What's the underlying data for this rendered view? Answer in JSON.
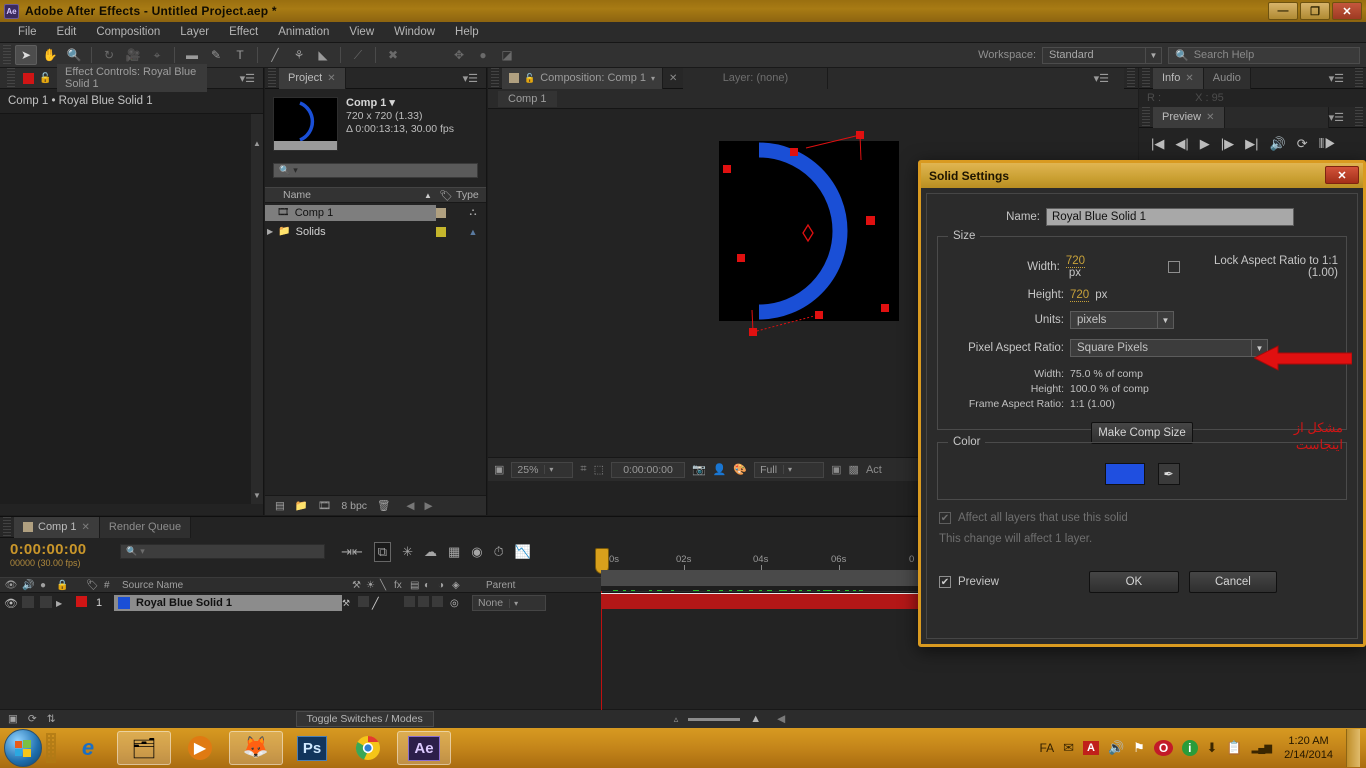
{
  "titlebar": {
    "app_icon": "ae-logo-icon",
    "title": "Adobe After Effects - Untitled Project.aep *",
    "minimize": "—",
    "restore": "❐",
    "close": "✕"
  },
  "menubar": {
    "items": [
      "File",
      "Edit",
      "Composition",
      "Layer",
      "Effect",
      "Animation",
      "View",
      "Window",
      "Help"
    ]
  },
  "toolbar": {
    "tools": [
      {
        "name": "selection-tool",
        "glyph": "➤",
        "active": true
      },
      {
        "name": "hand-tool",
        "glyph": "✋",
        "active": false
      },
      {
        "name": "zoom-tool",
        "glyph": "🔍",
        "active": false
      },
      {
        "name": "rotation-tool",
        "glyph": "↻",
        "active": false
      },
      {
        "name": "camera-tool",
        "glyph": "🎥",
        "active": false
      },
      {
        "name": "pan-behind-tool",
        "glyph": "⌖",
        "active": false
      },
      {
        "name": "shape-tool",
        "glyph": "▬",
        "active": false
      },
      {
        "name": "pen-tool",
        "glyph": "✎",
        "active": false
      },
      {
        "name": "type-tool",
        "glyph": "T",
        "active": false
      },
      {
        "name": "brush-tool",
        "glyph": "╱",
        "active": false
      },
      {
        "name": "clone-stamp-tool",
        "glyph": "⚘",
        "active": false
      },
      {
        "name": "eraser-tool",
        "glyph": "◣",
        "active": false
      },
      {
        "name": "roto-brush-tool",
        "glyph": "⟋",
        "active": false
      },
      {
        "name": "puppet-pin-tool",
        "glyph": "✖",
        "active": false
      }
    ],
    "right_tools": [
      {
        "name": "transform-icon",
        "glyph": "✥"
      },
      {
        "name": "dot-icon",
        "glyph": "●"
      },
      {
        "name": "mask-icon",
        "glyph": "◪"
      }
    ],
    "workspace_label": "Workspace:",
    "workspace_value": "Standard",
    "search_placeholder": "Search Help",
    "search_icon": "search-icon"
  },
  "effect_controls": {
    "tab_label": "Effect Controls: Royal Blue Solid 1",
    "swatch_icon": "red-square-icon",
    "lock_icon": "lock-icon",
    "menu_icon": "panel-menu-icon",
    "subtitle": "Comp 1 • Royal Blue Solid 1"
  },
  "project": {
    "tab_label": "Project",
    "tab_close": "✕",
    "menu_icon": "panel-menu-icon",
    "item_name": "Comp 1",
    "item_dropdown": "▾",
    "resolution": "720 x 720 (1.33)",
    "duration": "Δ 0:00:13:13, 30.00 fps",
    "search_icon": "search-icon",
    "search_dropdown": "▾",
    "columns": {
      "name": "Name",
      "sort": "▲",
      "tag": "tag-icon",
      "type": "Type"
    },
    "rows": [
      {
        "label": "Comp 1",
        "icon": "composition-icon",
        "color": "#b0a080",
        "selected": true
      },
      {
        "label": "Solids",
        "icon": "folder-icon",
        "color": "#c5b62c",
        "selected": false
      }
    ],
    "bottom": {
      "new_comp_icon": "new-composition-icon",
      "new_folder_icon": "new-folder-icon",
      "footage_icon": "footage-icon",
      "bit_depth": "8 bpc",
      "delete_icon": "trash-icon",
      "prev_icon": "◀",
      "next_icon": "▶"
    }
  },
  "composition": {
    "tab_label": "Composition: Comp 1",
    "tab_dropdown": "▾",
    "tab_close": "✕",
    "layer_tab": "Layer: (none)",
    "menu_icon": "panel-menu-icon",
    "subtab": "Comp 1",
    "viewer": {
      "solid_color": "#1a4fd6",
      "handle_color": "#e01010",
      "background": "#000000"
    },
    "bottom": {
      "toggle_view_icon": "toggle-view-icon",
      "zoom": "25%",
      "zoom_arrow": "▾",
      "region_icon": "region-of-interest-icon",
      "mask_icon": "mask-icon",
      "timecode": "0:00:00:00",
      "snapshot_icon": "camera-icon",
      "show_snapshot_icon": "person-icon",
      "channels_icon": "channels-icon",
      "resolution": "Full",
      "resolution_arrow": "▾",
      "region_interest_icon": "region-icon",
      "transparency_icon": "transparency-grid-icon",
      "active_camera": "Act"
    }
  },
  "info_panel": {
    "tab_label": "Info",
    "tab_close": "✕",
    "audio_tab": "Audio",
    "menu_icon": "panel-menu-icon",
    "r_label": "R :",
    "x_label": "X : 95"
  },
  "preview_panel": {
    "tab_label": "Preview",
    "tab_close": "✕",
    "menu_icon": "panel-menu-icon",
    "controls": [
      {
        "name": "first-frame-button",
        "glyph": "|◀"
      },
      {
        "name": "previous-frame-button",
        "glyph": "◀|"
      },
      {
        "name": "play-button",
        "glyph": "▶"
      },
      {
        "name": "next-frame-button",
        "glyph": "|▶"
      },
      {
        "name": "last-frame-button",
        "glyph": "▶|"
      },
      {
        "name": "audio-button",
        "glyph": "🔊"
      },
      {
        "name": "loop-button",
        "glyph": "⟳"
      },
      {
        "name": "ram-preview-button",
        "glyph": "⦀▶"
      }
    ]
  },
  "timeline": {
    "tabs": [
      {
        "label": "Comp 1",
        "close": "✕",
        "selected": true
      },
      {
        "label": "Render Queue",
        "close": "",
        "selected": false
      }
    ],
    "current_time": "0:00:00:00",
    "frame_info": "00000 (30.00 fps)",
    "search_icon": "search-icon",
    "search_dropdown": "▾",
    "icons": [
      {
        "name": "live-update-icon",
        "glyph": "⇥⇤"
      },
      {
        "name": "draft-3d-icon",
        "glyph": "⧉"
      },
      {
        "name": "hide-shy-layers-icon",
        "glyph": "✳"
      },
      {
        "name": "motion-blur-icon",
        "glyph": "☁"
      },
      {
        "name": "brainstorm-icon",
        "glyph": "▦"
      },
      {
        "name": "graph-editor-icon",
        "glyph": "◉"
      },
      {
        "name": "auto-keyframe-icon",
        "glyph": "⏱"
      },
      {
        "name": "curves-icon",
        "glyph": "📉"
      }
    ],
    "columns": {
      "eye": "eye-icon",
      "audio": "audio-icon",
      "solo": "solo-icon",
      "lock": "lock-icon",
      "label": "label-icon",
      "num": "#",
      "source_name": "Source Name",
      "switches": [
        "⚒",
        "☀",
        "╲",
        "fx",
        "▤",
        "◐",
        "◑",
        "◈"
      ],
      "parent": "Parent"
    },
    "rows": [
      {
        "num": "1",
        "name": "Royal Blue Solid 1",
        "color": "#1a4fd6",
        "label_color": "#d01515",
        "parent": "None",
        "parent_arrow": "▾"
      }
    ],
    "ruler_marks": [
      "0s",
      "02s",
      "04s",
      "06s",
      "0"
    ],
    "bottom": {
      "toggle_label": "Toggle Switches / Modes",
      "icons": [
        {
          "name": "comp-flowchart-icon",
          "glyph": "▣"
        },
        {
          "name": "motion-sketch-icon",
          "glyph": "⟳"
        },
        {
          "name": "layer-switches-icon",
          "glyph": "⇅"
        }
      ],
      "zoom_out_icon": "▵",
      "zoom_in_icon": "▲",
      "prev_icon": "◀"
    }
  },
  "dialog": {
    "title": "Solid Settings",
    "close_glyph": "✕",
    "name_label": "Name:",
    "name_value": "Royal Blue Solid 1",
    "size_group": "Size",
    "width_label": "Width:",
    "width_value": "720",
    "width_unit": "px",
    "height_label": "Height:",
    "height_value": "720",
    "height_unit": "px",
    "lock_aspect_label": "Lock Aspect Ratio to 1:1 (1.00)",
    "lock_aspect_checked": false,
    "units_label": "Units:",
    "units_value": "pixels",
    "par_label": "Pixel Aspect Ratio:",
    "par_value": "Square Pixels",
    "stat_width_label": "Width:",
    "stat_width_value": "75.0 % of comp",
    "stat_height_label": "Height:",
    "stat_height_value": "100.0 % of comp",
    "stat_far_label": "Frame Aspect Ratio:",
    "stat_far_value": "1:1 (1.00)",
    "make_comp_size": "Make Comp Size",
    "color_group": "Color",
    "color_value": "#1f4fe0",
    "eyedropper_icon": "eyedropper-icon",
    "affect_all_label": "Affect all layers that use this solid",
    "affect_all_checked": true,
    "change_note": "This change will affect 1 layer.",
    "preview_label": "Preview",
    "preview_checked": true,
    "ok_label": "OK",
    "cancel_label": "Cancel",
    "annotation_line1": "مشکل از",
    "annotation_line2": "اینجاست",
    "annotation_color": "#d01515",
    "arrow_color": "#e01010"
  },
  "taskbar": {
    "start_icon": "windows-start-icon",
    "items": [
      {
        "name": "taskbar-internet-explorer",
        "glyph": "e",
        "open": false
      },
      {
        "name": "taskbar-file-explorer",
        "glyph": "🗂",
        "open": true
      },
      {
        "name": "taskbar-media-player",
        "glyph": "▶",
        "open": false
      },
      {
        "name": "taskbar-firefox",
        "glyph": "🦊",
        "open": true
      },
      {
        "name": "taskbar-photoshop",
        "glyph": "Ps",
        "open": false
      },
      {
        "name": "taskbar-chrome",
        "glyph": "◉",
        "open": false
      },
      {
        "name": "taskbar-after-effects",
        "glyph": "Ae",
        "open": true
      }
    ],
    "language": "FA",
    "tray_icons": [
      {
        "name": "tray-messenger-icon",
        "glyph": "✉"
      },
      {
        "name": "tray-adobe-icon",
        "glyph": "A"
      },
      {
        "name": "tray-volume-icon",
        "glyph": "🔊"
      },
      {
        "name": "tray-network-flag-icon",
        "glyph": "⚑"
      },
      {
        "name": "tray-opera-icon",
        "glyph": "O"
      },
      {
        "name": "tray-info-icon",
        "glyph": "i"
      },
      {
        "name": "tray-download-icon",
        "glyph": "⬇"
      },
      {
        "name": "tray-clipboard-icon",
        "glyph": "📋"
      },
      {
        "name": "tray-signal-icon",
        "glyph": "▂▄▆"
      }
    ],
    "time": "1:20 AM",
    "date": "2/14/2014"
  }
}
